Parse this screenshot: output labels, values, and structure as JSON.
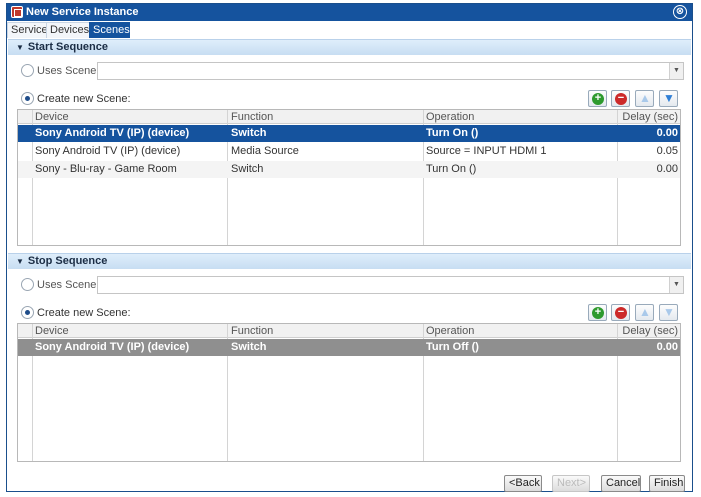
{
  "window": {
    "title": "New Service Instance",
    "close_glyph": "⊗"
  },
  "tabs": [
    {
      "label": "Service"
    },
    {
      "label": "Devices"
    },
    {
      "label": "Scenes"
    }
  ],
  "start_sequence": {
    "header": "Start Sequence",
    "uses_scene_label": "Uses Scene:",
    "uses_scene_value": "",
    "create_new_label": "Create new Scene:",
    "columns": [
      "Device",
      "Function",
      "Operation",
      "Delay (sec)"
    ],
    "rows": [
      {
        "device": "Sony Android TV (IP) (device)",
        "function": "Switch",
        "operation": "Turn On ()",
        "delay": "0.00"
      },
      {
        "device": "Sony Android TV (IP) (device)",
        "function": "Media Source",
        "operation": "Source = INPUT HDMI 1",
        "delay": "0.05"
      },
      {
        "device": "Sony - Blu-ray - Game Room",
        "function": "Switch",
        "operation": "Turn On ()",
        "delay": "0.00"
      }
    ]
  },
  "stop_sequence": {
    "header": "Stop Sequence",
    "uses_scene_label": "Uses Scene:",
    "uses_scene_value": "",
    "create_new_label": "Create new Scene:",
    "columns": [
      "Device",
      "Function",
      "Operation",
      "Delay (sec)"
    ],
    "rows": [
      {
        "device": "Sony Android TV (IP) (device)",
        "function": "Switch",
        "operation": "Turn Off ()",
        "delay": "0.00"
      }
    ]
  },
  "toolbar_glyphs": {
    "add": "+",
    "remove": "−",
    "up": "▲",
    "down": "▼"
  },
  "footer": {
    "back": "<Back",
    "next": "Next>",
    "cancel": "Cancel",
    "finish": "Finish"
  },
  "colors": {
    "accent": "#15539e",
    "header_band": "#c7ddf2",
    "add": "#2e9a2e",
    "remove": "#cc2a2a"
  }
}
